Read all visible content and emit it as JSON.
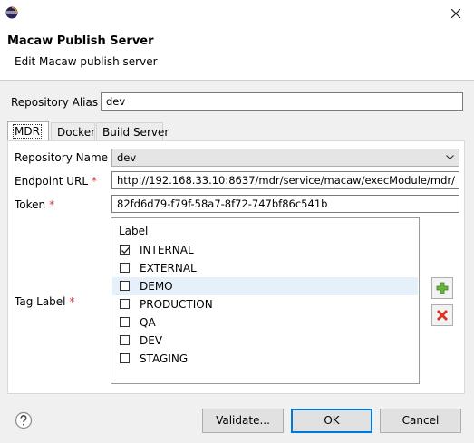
{
  "window": {
    "title": ""
  },
  "banner": {
    "title": "Macaw Publish Server",
    "subtitle": "Edit Macaw publish server"
  },
  "alias": {
    "label": "Repository Alias",
    "value": "dev"
  },
  "tabs": [
    {
      "label": "MDR"
    },
    {
      "label": "Docker"
    },
    {
      "label": "Build Server"
    }
  ],
  "repo_name": {
    "label": "Repository Name",
    "value": "dev"
  },
  "endpoint": {
    "label": "Endpoint URL",
    "value": "http://192.168.33.10:8637/mdr/service/macaw/execModule/mdr/"
  },
  "token": {
    "label": "Token",
    "value": "82fd6d79-f79f-58a7-8f72-747bf86c541b"
  },
  "tag": {
    "label": "Tag Label",
    "column": "Label",
    "items": [
      {
        "label": "INTERNAL",
        "checked": true
      },
      {
        "label": "EXTERNAL",
        "checked": false
      },
      {
        "label": "DEMO",
        "checked": false,
        "selected": true
      },
      {
        "label": "PRODUCTION",
        "checked": false
      },
      {
        "label": "QA",
        "checked": false
      },
      {
        "label": "DEV",
        "checked": false
      },
      {
        "label": "STAGING",
        "checked": false
      }
    ]
  },
  "required_mark": "*",
  "buttons": {
    "validate": "Validate...",
    "ok": "OK",
    "cancel": "Cancel"
  },
  "icons": {
    "app": "eclipse-icon",
    "close": "close-icon",
    "add": "add-icon",
    "remove": "remove-icon",
    "help": "help-icon"
  },
  "colors": {
    "required": "#d23b3b",
    "add": "#5aa02c",
    "remove": "#d9352b",
    "selection": "#e6f0fa"
  }
}
